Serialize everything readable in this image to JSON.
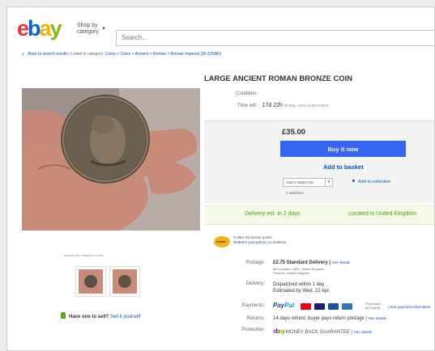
{
  "header": {
    "logo_letters": [
      "e",
      "b",
      "a",
      "y"
    ],
    "shop_by_category": [
      "Shop by",
      "category"
    ],
    "search_placeholder": "Search..."
  },
  "breadcrumb": {
    "back": "Back to search results",
    "listed_in": "| Listed in category:",
    "path": "Coins > Coins > Ancient > Roman > Roman Imperial (96-235AD)"
  },
  "gallery": {
    "zoom_hint": "Mouse over image to zoom"
  },
  "sell": {
    "question": "Have one to sell?",
    "link": "Sell it yourself"
  },
  "listing": {
    "title": "LARGE ANCIENT ROMAN BRONZE COIN",
    "condition_label": "Condition:",
    "time_left_label": "Time left:",
    "time_left_value": "17d 22h",
    "time_left_detail": "03 May, 2015 14:59:23 BST",
    "price": "£35.00",
    "buy_now": "Buy it now",
    "add_to_basket": "Add to basket",
    "add_to_watch": "Add to Watch list",
    "add_to_collection": "Add to collection",
    "watchers": "2 watchers",
    "delivery_est": "Delivery est. in 2 days",
    "located": "Located in United Kingdom"
  },
  "nectar": {
    "line1": "Collect 35 Nectar points",
    "line2_link": "Redeem your points",
    "line2_sep": "| Conditions"
  },
  "details": {
    "postage_label": "Postage:",
    "postage_value": "£2.75",
    "postage_service": "Standard Delivery |",
    "postage_link": "See details",
    "item_location": "Item location: MIIV, United Kingdom",
    "posts_to": "Posts to: United Kingdom",
    "delivery_label": "Delivery:",
    "dispatch": "Dispatched within 1 day",
    "estimated": "Estimated by Wed. 22 Apr.",
    "payments_label": "Payments:",
    "paypal_processed": "Processed",
    "paypal_by": "by PayPal",
    "payment_link": "| See payment information",
    "returns_label": "Returns:",
    "returns_value": "14 days refund, buyer pays return postage |",
    "returns_link": "See details",
    "protection_label": "Protection:",
    "protection_value": "MONEY BACK GUARANTEE |",
    "protection_link": "See details"
  },
  "colors": {
    "ebay_red": "#e53238",
    "ebay_blue": "#0064d2",
    "ebay_yellow": "#f5af02",
    "ebay_green": "#86b817",
    "buy_button": "#3665f3",
    "link": "#0654ba",
    "delivery_green": "#4c9a00"
  }
}
